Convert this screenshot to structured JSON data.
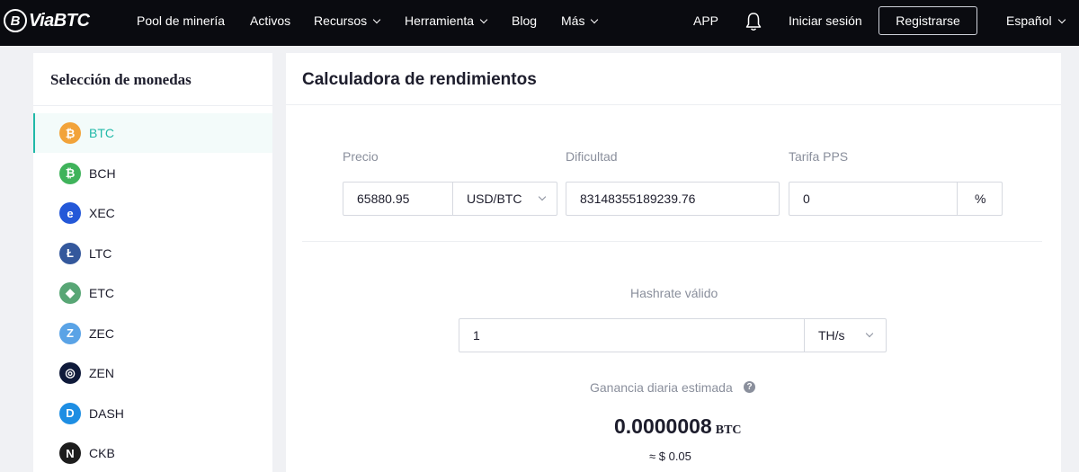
{
  "nav": {
    "logo": "ViaBTC",
    "items": [
      {
        "label": "Pool de minería",
        "dropdown": false
      },
      {
        "label": "Activos",
        "dropdown": false
      },
      {
        "label": "Recursos",
        "dropdown": true
      },
      {
        "label": "Herramienta",
        "dropdown": true
      },
      {
        "label": "Blog",
        "dropdown": false
      },
      {
        "label": "Más",
        "dropdown": true
      }
    ],
    "app": "APP",
    "login": "Iniciar sesión",
    "register": "Registrarse",
    "language": "Español"
  },
  "sidebar": {
    "title": "Selección de monedas",
    "coins": [
      {
        "label": "BTC",
        "glyph": "₿",
        "color": "#f2a33a",
        "active": true
      },
      {
        "label": "BCH",
        "glyph": "₿",
        "color": "#3fb35b",
        "active": false
      },
      {
        "label": "XEC",
        "glyph": "e",
        "color": "#2458d8",
        "active": false
      },
      {
        "label": "LTC",
        "glyph": "Ł",
        "color": "#34589c",
        "active": false
      },
      {
        "label": "ETC",
        "glyph": "◆",
        "color": "#58a675",
        "active": false
      },
      {
        "label": "ZEC",
        "glyph": "Z",
        "color": "#5aa3e6",
        "active": false
      },
      {
        "label": "ZEN",
        "glyph": "◎",
        "color": "#0f1a3a",
        "active": false
      },
      {
        "label": "DASH",
        "glyph": "D",
        "color": "#1e8ee3",
        "active": false
      },
      {
        "label": "CKB",
        "glyph": "N",
        "color": "#1d1d1d",
        "active": false
      }
    ]
  },
  "calculator": {
    "title": "Calculadora de rendimientos",
    "price_label": "Precio",
    "price_value": "65880.95",
    "price_unit": "USD/BTC",
    "difficulty_label": "Dificultad",
    "difficulty_value": "83148355189239.76",
    "fee_label": "Tarifa PPS",
    "fee_value": "0",
    "fee_unit": "%",
    "hashrate_label": "Hashrate válido",
    "hashrate_value": "1",
    "hashrate_unit": "TH/s",
    "earnings_label": "Ganancia diaria estimada",
    "earnings_value": "0.0000008",
    "earnings_unit": "BTC",
    "earnings_usd": "≈ $ 0.05"
  }
}
